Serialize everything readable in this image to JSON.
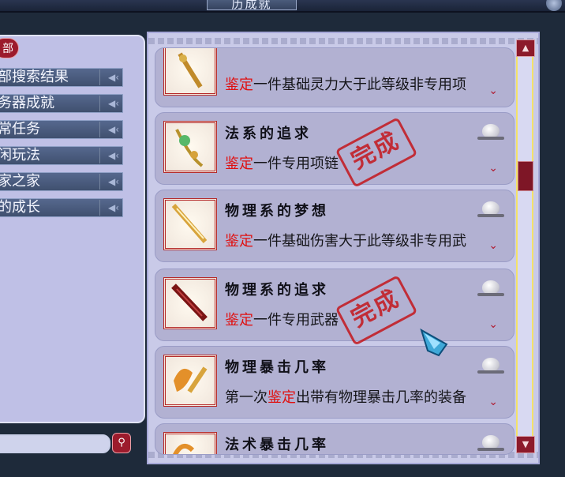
{
  "window": {
    "title": "历成就"
  },
  "left_panel": {
    "pill_label": "部",
    "categories": [
      {
        "label": "部搜索结果"
      },
      {
        "label": "务器成就"
      },
      {
        "label": "常任务"
      },
      {
        "label": "闲玩法"
      },
      {
        "label": "家之家"
      },
      {
        "label": "的成长"
      }
    ],
    "search": {
      "value": "",
      "button_icon": "search-icon"
    }
  },
  "achievements": [
    {
      "title": "",
      "desc_prefix": "",
      "keyword": "鉴定",
      "desc_suffix": "一件基础灵力大于此等级非专用项",
      "completed": false,
      "item_icon": "necklace-icon"
    },
    {
      "title": "法系的追求",
      "desc_prefix": "",
      "keyword": "鉴定",
      "desc_suffix": "一件专用项链",
      "completed": true,
      "stamp": "完成",
      "item_icon": "necklace-icon"
    },
    {
      "title": "物理系的梦想",
      "desc_prefix": "",
      "keyword": "鉴定",
      "desc_suffix": "一件基础伤害大于此等级非专用武",
      "completed": false,
      "item_icon": "sword-icon"
    },
    {
      "title": "物理系的追求",
      "desc_prefix": "",
      "keyword": "鉴定",
      "desc_suffix": "一件专用武器",
      "completed": true,
      "stamp": "完成",
      "item_icon": "sword-icon"
    },
    {
      "title": "物理暴击几率",
      "desc_prefix": "第一次",
      "keyword": "鉴定",
      "desc_suffix": "出带有物理暴击几率的装备",
      "completed": false,
      "item_icon": "fan-icon"
    },
    {
      "title": "法术暴击几率",
      "desc_prefix": "",
      "keyword": "",
      "desc_suffix": "",
      "completed": false,
      "item_icon": "fan-icon"
    }
  ],
  "colors": {
    "keyword": "#e01010",
    "stamp": "#c4161c",
    "accent_red": "#9c1b2c"
  }
}
